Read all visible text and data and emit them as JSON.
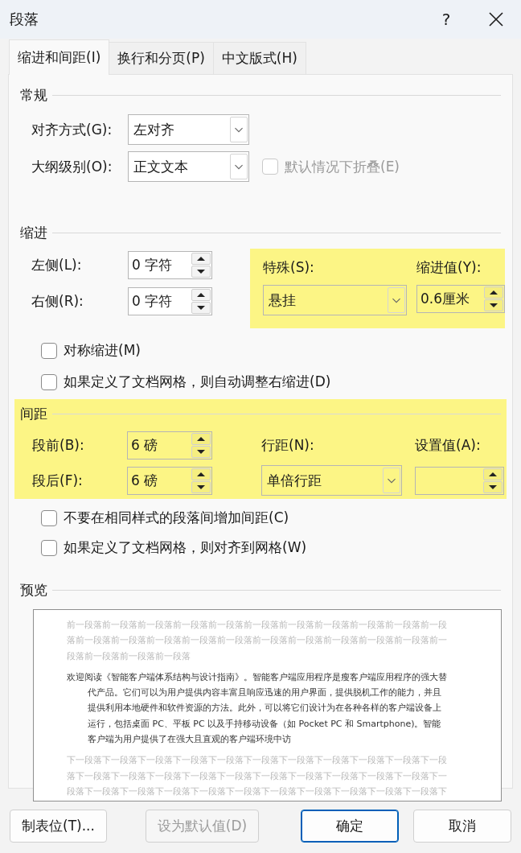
{
  "window": {
    "title": "段落",
    "help": "?"
  },
  "tabs": [
    {
      "label": "缩进和间距(I)",
      "selected": true
    },
    {
      "label": "换行和分页(P)",
      "selected": false
    },
    {
      "label": "中文版式(H)",
      "selected": false
    }
  ],
  "general": {
    "heading": "常规",
    "alignment": {
      "label": "对齐方式(G):",
      "value": "左对齐"
    },
    "outline_level": {
      "label": "大纲级别(O):",
      "value": "正文文本"
    },
    "collapse": {
      "label": "默认情况下折叠(E)",
      "checked": false,
      "disabled": true
    }
  },
  "indent": {
    "heading": "缩进",
    "left": {
      "label": "左侧(L):",
      "value": "0 字符"
    },
    "right": {
      "label": "右侧(R):",
      "value": "0 字符"
    },
    "special": {
      "label": "特殊(S):",
      "value": "悬挂"
    },
    "by": {
      "label": "缩进值(Y):",
      "value": "0.6厘米"
    },
    "highlighted": true,
    "checkboxes": [
      {
        "label": "对称缩进(M)",
        "checked": false
      },
      {
        "label": "如果定义了文档网格，则自动调整右缩进(D)",
        "checked": false
      }
    ]
  },
  "spacing": {
    "heading": "间距",
    "highlighted": true,
    "before": {
      "label": "段前(B):",
      "value": "6 磅"
    },
    "after": {
      "label": "段后(F):",
      "value": "6 磅"
    },
    "line_spacing": {
      "label": "行距(N):",
      "value": "单倍行距"
    },
    "at": {
      "label": "设置值(A):"
    },
    "checkboxes": [
      {
        "label": "不要在相同样式的段落间增加间距(C)",
        "checked": false
      },
      {
        "label": "如果定义了文档网格，则对齐到网格(W)",
        "checked": false
      }
    ]
  },
  "preview": {
    "heading": "预览",
    "previous_paragraph": "前一段落前一段落前一段落前一段落前一段落前一段落前一段落前一段落前一段落前一段落前一段落前一段落前一段落前一段落前一段落前一段落前一段落前一段落前一段落前一段落前一段落前一段落前一段落前一段落前一段落",
    "paragraph": "欢迎阅读《智能客户端体系结构与设计指南》。智能客户端应用程序是瘦客户端应用程序的强大替代产品。它们可以为用户提供内容丰富且响应迅速的用户界面，提供脱机工作的能力，并且提供利用本地硬件和软件资源的方法。此外，可以将它们设计为在各种各样的客户端设备上运行，包括桌面 PC、平板 PC 以及手持移动设备（如 Pocket PC 和 Smartphone)。智能客户端为用户提供了在强大且直观的客户端环境中访",
    "next_paragraph": "下一段落下一段落下一段落下一段落下一段落下一段落下一段落下一段落下一段落下一段落下一段落下一段落下一段落下一段落下一段落下一段落下一段落下一段落下一段落下一段落下一段落下一段落下一段落下一段落下一段落下一段落下一段落下一段落下一段落下一段落下一段落下一段落下"
  },
  "buttons": [
    {
      "label": "制表位(T)...",
      "disabled": false,
      "default": false
    },
    {
      "label": "设为默认值(D)",
      "disabled": true,
      "default": false
    },
    {
      "label": "确定",
      "disabled": false,
      "default": true
    },
    {
      "label": "取消",
      "disabled": false,
      "default": false
    }
  ]
}
